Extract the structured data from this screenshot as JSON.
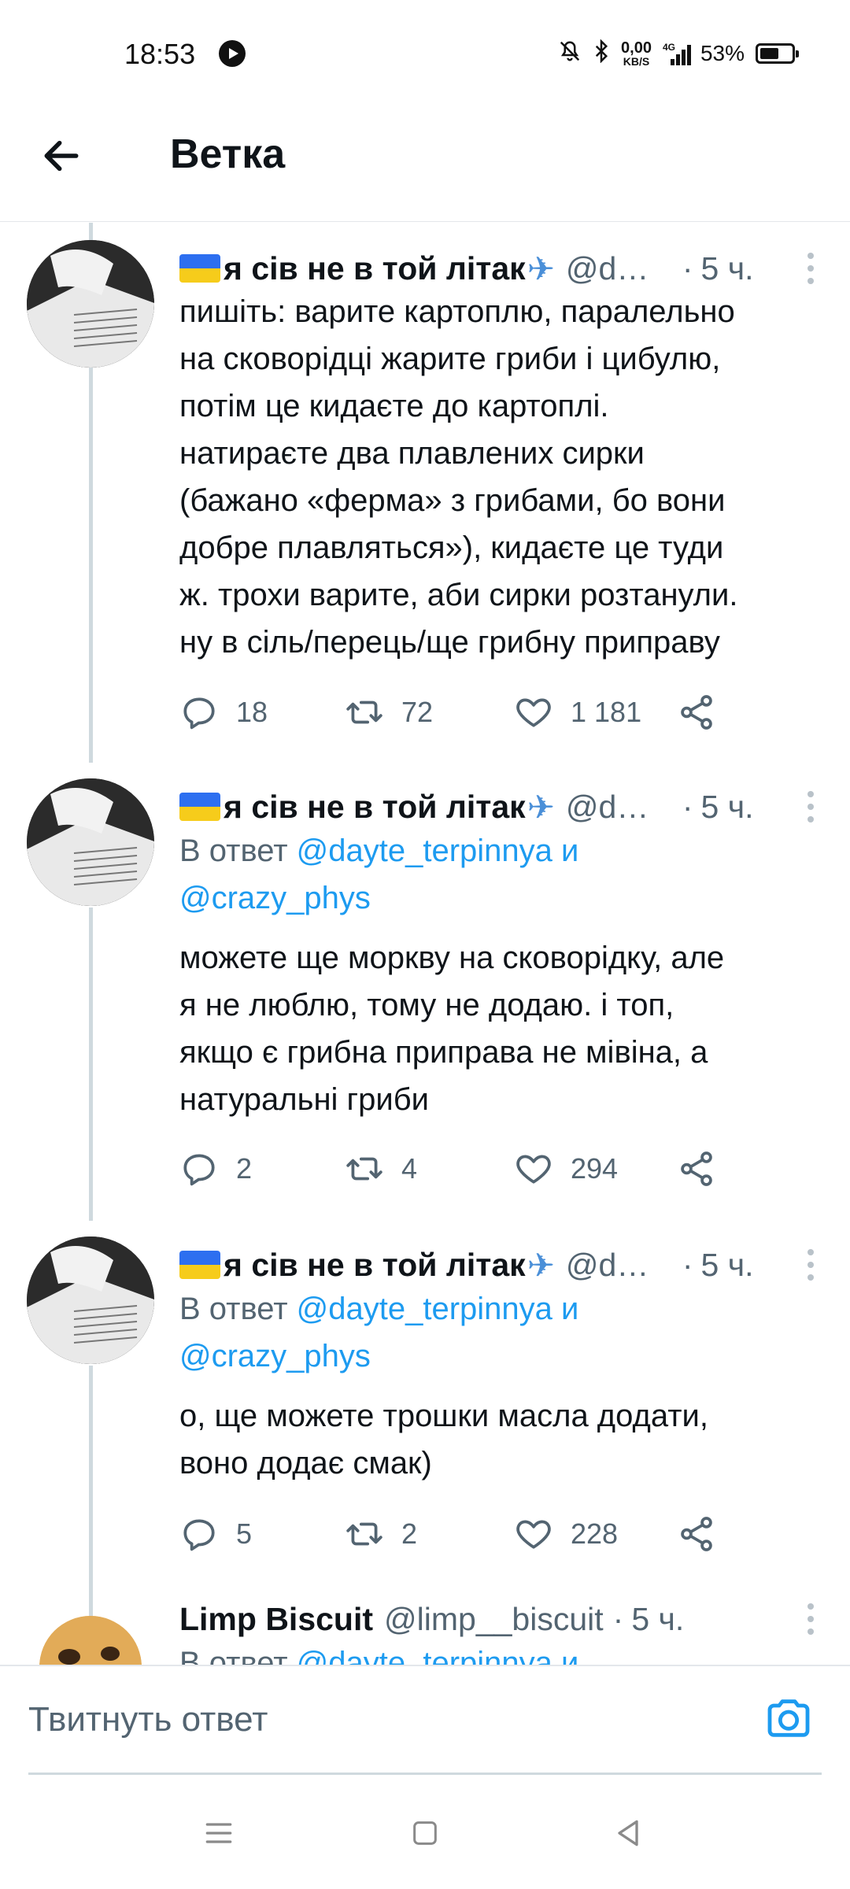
{
  "status_bar": {
    "time": "18:53",
    "net_speed_value": "0,00",
    "net_speed_unit": "KB/S",
    "network_type": "4G",
    "battery_percent": "53%",
    "battery_level": 0.53
  },
  "header": {
    "title": "Ветка",
    "back_icon": "arrow-left-icon"
  },
  "tweets": [
    {
      "display_name": "я сів не в той літак",
      "handle": "@dayte_terpinnya",
      "time": "5 ч.",
      "flag": "ukraine-flag-emoji",
      "name_emoji": "airplane-emoji",
      "reply_to_prefix": "",
      "reply_to": "",
      "text_lines": [
        "пишіть: варите картоплю, паралельно",
        "на сковорідці жарите гриби і цибулю,",
        "потім це кидаєте до картоплі.",
        "натираєте два плавлених сирки",
        "(бажано «ферма» з грибами, бо вони",
        "добре плавляться»), кидаєте це туди",
        "ж. трохи варите, аби сирки розтанули.",
        "ну в сіль/перець/ще грибну приправу"
      ],
      "replies": "18",
      "retweets": "72",
      "likes": "1 181"
    },
    {
      "display_name": "я сів не в той літак",
      "handle": "@dayte_terpinnya",
      "time": "5 ч.",
      "flag": "ukraine-flag-emoji",
      "name_emoji": "airplane-emoji",
      "reply_to_prefix": "В ответ",
      "reply_mention_1": "@dayte_terpinnya",
      "reply_conjunction": "и",
      "reply_mention_2": "@crazy_phys",
      "text_lines": [
        "можете ще моркву на сковорідку, але",
        "я не люблю, тому не додаю. і топ,",
        "якщо є грибна приправа не мівіна, а",
        "натуральні гриби"
      ],
      "replies": "2",
      "retweets": "4",
      "likes": "294"
    },
    {
      "display_name": "я сів не в той літак",
      "handle": "@dayte_terpinnya",
      "time": "5 ч.",
      "flag": "ukraine-flag-emoji",
      "name_emoji": "airplane-emoji",
      "reply_to_prefix": "В ответ",
      "reply_mention_1": "@dayte_terpinnya",
      "reply_conjunction": "и",
      "reply_mention_2": "@crazy_phys",
      "text_lines": [
        "о, ще можете трошки масла додати,",
        "воно додає смак)"
      ],
      "replies": "5",
      "retweets": "2",
      "likes": "228"
    },
    {
      "display_name": "Limp Biscuit",
      "handle": "@limp__biscuit",
      "time": "5 ч.",
      "reply_to_prefix": "В ответ",
      "reply_mention_1": "@dayte_terpinnya",
      "reply_conjunction": "и"
    }
  ],
  "compose": {
    "placeholder": "Твитнуть ответ",
    "camera_icon": "camera-icon"
  },
  "navbar": {
    "menu_icon": "menu-icon",
    "home_icon": "home-square-icon",
    "back_icon": "back-triangle-icon"
  },
  "colors": {
    "accent": "#1d9bf0",
    "text_primary": "#0f1419",
    "text_secondary": "#536471",
    "thread_line": "#cfd9de"
  }
}
